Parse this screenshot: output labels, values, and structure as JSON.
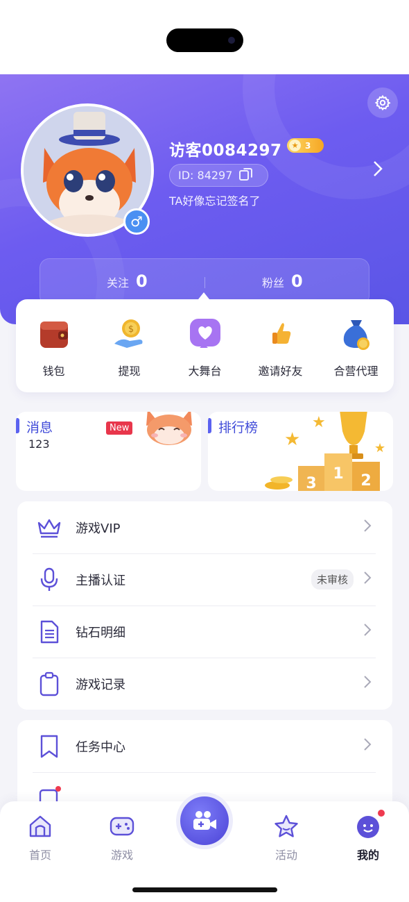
{
  "profile": {
    "username": "访客0084297",
    "level": "3",
    "id_text": "ID: 84297",
    "signature": "TA好像忘记签名了",
    "gender_symbol": "♂"
  },
  "stats": {
    "following_label": "关注",
    "following_count": "0",
    "fans_label": "粉丝",
    "fans_count": "0"
  },
  "quick_actions": [
    {
      "label": "钱包",
      "icon": "wallet-icon"
    },
    {
      "label": "提现",
      "icon": "coin-hand-icon"
    },
    {
      "label": "大舞台",
      "icon": "heart-chat-icon"
    },
    {
      "label": "邀请好友",
      "icon": "thumbs-up-icon"
    },
    {
      "label": "合营代理",
      "icon": "money-bag-icon"
    }
  ],
  "messages": {
    "title": "消息",
    "count": "123",
    "badge": "New"
  },
  "ranking": {
    "title": "排行榜",
    "podium": [
      "3",
      "1",
      "2"
    ]
  },
  "menu_group_1": [
    {
      "label": "游戏VIP",
      "icon": "crown-icon"
    },
    {
      "label": "主播认证",
      "icon": "microphone-icon",
      "tag": "未审核"
    },
    {
      "label": "钻石明细",
      "icon": "document-icon"
    },
    {
      "label": "游戏记录",
      "icon": "clipboard-icon"
    }
  ],
  "menu_group_2": [
    {
      "label": "任务中心",
      "icon": "bookmark-icon"
    }
  ],
  "tabbar": [
    {
      "label": "首页",
      "icon": "home-icon"
    },
    {
      "label": "游戏",
      "icon": "gamepad-icon"
    },
    {
      "label": "",
      "icon": "live-camera-icon"
    },
    {
      "label": "活动",
      "icon": "star-icon"
    },
    {
      "label": "我的",
      "icon": "profile-face-icon",
      "active": true
    }
  ],
  "colors": {
    "brand": "#6d5cf0",
    "accent": "#5b62f0",
    "badge_red": "#e8364b"
  }
}
